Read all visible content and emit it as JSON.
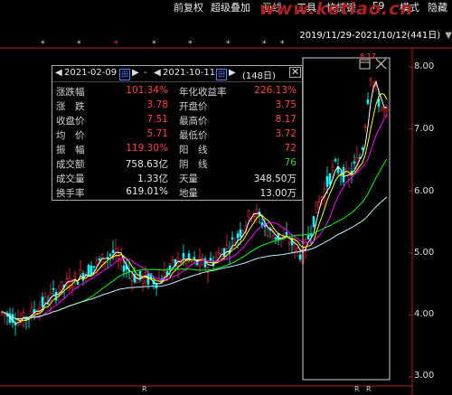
{
  "menu": {
    "items": [
      "前复权",
      "超级叠加",
      "画线",
      "工具",
      "快捷键",
      "F9",
      "模式",
      "隐藏"
    ],
    "watermark": "www.ketiao.cn"
  },
  "date_range": "2019/11/29-2021/10/12(441日)",
  "panel": {
    "start_date": "2021-02-09",
    "separator": "-",
    "end_date": "2021-10-11",
    "days": "(148日)",
    "rows": [
      [
        {
          "label": "涨跌幅",
          "value": "101.34%",
          "color": "red"
        },
        {
          "label": "年化收益率",
          "value": "226.13%",
          "color": "red"
        }
      ],
      [
        {
          "label": "涨　跌",
          "value": "3.78",
          "color": "red"
        },
        {
          "label": "开盘价",
          "value": "3.75",
          "color": "red"
        }
      ],
      [
        {
          "label": "收盘价",
          "value": "7.51",
          "color": "red"
        },
        {
          "label": "最高价",
          "value": "8.17",
          "color": "red"
        }
      ],
      [
        {
          "label": "均　价",
          "value": "5.71",
          "color": "red"
        },
        {
          "label": "最低价",
          "value": "3.72",
          "color": "red"
        }
      ],
      [
        {
          "label": "振　幅",
          "value": "119.30%",
          "color": "red"
        },
        {
          "label": "阳　线",
          "value": "72",
          "color": "red"
        }
      ],
      [
        {
          "label": "成交额",
          "value": "758.63亿",
          "color": "white"
        },
        {
          "label": "阴　线",
          "value": "76",
          "color": "green"
        }
      ],
      [
        {
          "label": "成交量",
          "value": "1.33亿",
          "color": "white"
        },
        {
          "label": "天量",
          "value": "348.50万",
          "color": "white"
        }
      ],
      [
        {
          "label": "换手率",
          "value": "619.01%",
          "color": "white"
        },
        {
          "label": "地量",
          "value": "13.00万",
          "color": "white"
        }
      ]
    ]
  },
  "y_axis": {
    "ticks": [
      "8.00",
      "7.00",
      "6.00",
      "5.00",
      "4.00",
      "3.00"
    ],
    "range": [
      3.0,
      8.0
    ]
  },
  "peak_label": "8.17",
  "r_markers": [
    "R",
    "R",
    "R"
  ],
  "colors": {
    "up": "#ff3030",
    "down": "#00ffff",
    "ma5": "#ffffff",
    "ma10": "#ffff00",
    "ma20": "#ff00ff",
    "ma60": "#00ff00",
    "ma120": "#c0f0ff"
  }
}
